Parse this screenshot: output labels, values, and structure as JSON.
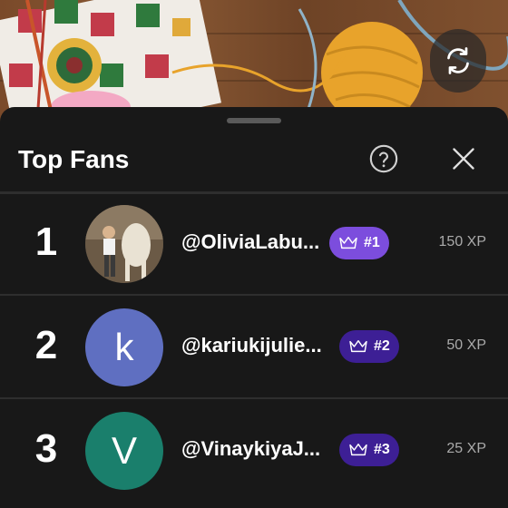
{
  "colors": {
    "sheet_bg": "#181818",
    "badge_first": "#7c4ddd",
    "badge_other": "#3d1f95",
    "avatar_k": "#5f6fc1",
    "avatar_v": "#1a7f6c"
  },
  "controls": {
    "rotate_icon": "rotate-icon",
    "help_icon": "help-circle-icon",
    "close_icon": "close-icon"
  },
  "sheet": {
    "title": "Top Fans"
  },
  "fans": [
    {
      "rank": "1",
      "handle": "@OliviaLabu...",
      "badge": "#1",
      "xp": "150 XP",
      "avatar_type": "photo",
      "avatar_letter": ""
    },
    {
      "rank": "2",
      "handle": "@kariukijulie...",
      "badge": "#2",
      "xp": "50 XP",
      "avatar_type": "letter",
      "avatar_letter": "k"
    },
    {
      "rank": "3",
      "handle": "@VinaykiyaJ...",
      "badge": "#3",
      "xp": "25 XP",
      "avatar_type": "letter",
      "avatar_letter": "V"
    }
  ]
}
